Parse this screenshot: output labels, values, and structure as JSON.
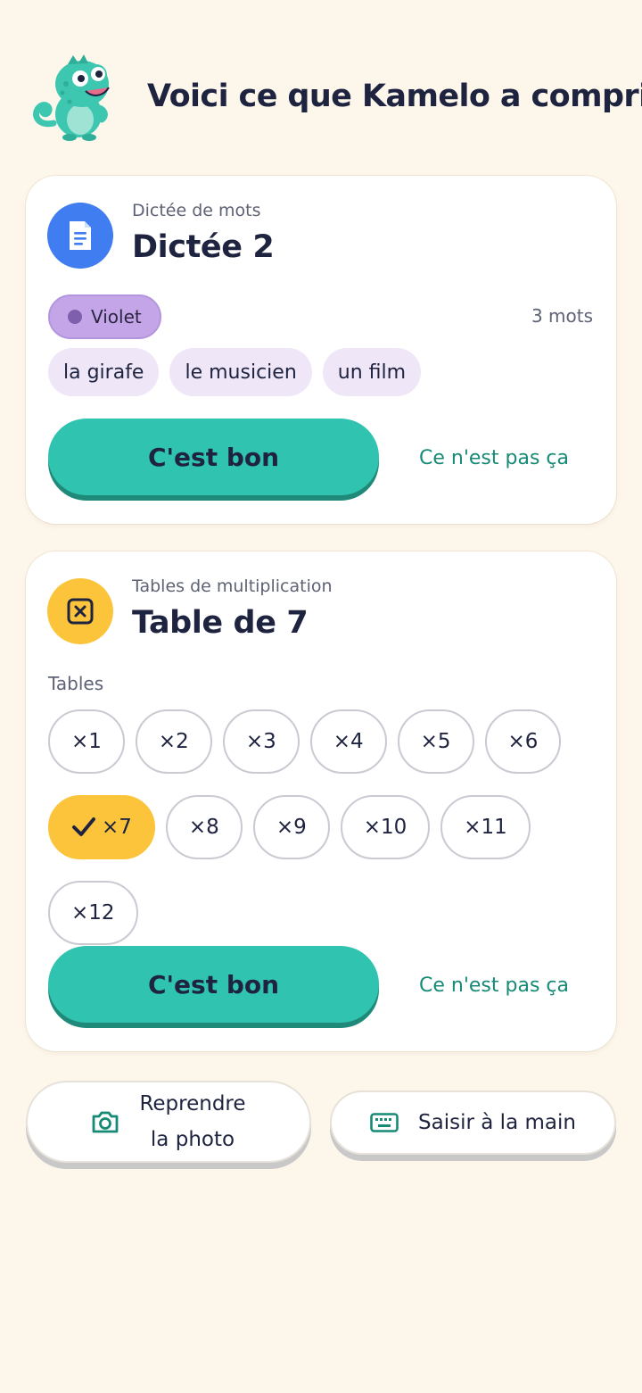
{
  "header": {
    "title": "Voici ce que Kamelo a compris",
    "mascot_icon": "chameleon-mascot-icon"
  },
  "dictation_card": {
    "icon": "document-icon",
    "category": "Dictée de mots",
    "title": "Dictée 2",
    "list_label": "Violet",
    "list_color": "#c4a6e8",
    "word_count": "3 mots",
    "words": [
      "la girafe",
      "le musicien",
      "un film"
    ],
    "confirm_label": "C'est bon",
    "reject_label": "Ce n'est pas ça"
  },
  "tables_card": {
    "icon": "multiply-box-icon",
    "category": "Tables de multiplication",
    "title": "Table de 7",
    "tables_label": "Tables",
    "tables": [
      {
        "label": "×1",
        "selected": false
      },
      {
        "label": "×2",
        "selected": false
      },
      {
        "label": "×3",
        "selected": false
      },
      {
        "label": "×4",
        "selected": false
      },
      {
        "label": "×5",
        "selected": false
      },
      {
        "label": "×6",
        "selected": false
      },
      {
        "label": "×7",
        "selected": true
      },
      {
        "label": "×8",
        "selected": false
      },
      {
        "label": "×9",
        "selected": false
      },
      {
        "label": "×10",
        "selected": false
      },
      {
        "label": "×11",
        "selected": false
      },
      {
        "label": "×12",
        "selected": false
      }
    ],
    "confirm_label": "C'est bon",
    "reject_label": "Ce n'est pas ça"
  },
  "bottom_actions": {
    "retake_line1": "Reprendre",
    "retake_line2": "la photo",
    "retake_icon": "camera-icon",
    "manual_label": "Saisir à la main",
    "manual_icon": "keyboard-icon"
  },
  "colors": {
    "background": "#fdf6ea",
    "accent": "#30c4b0",
    "link": "#178a76",
    "selected_chip": "#fcc43b"
  }
}
